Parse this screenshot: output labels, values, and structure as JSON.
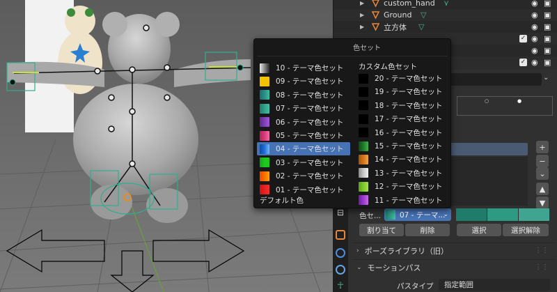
{
  "outliner": {
    "items": [
      {
        "name": "custom_hand",
        "icon": "armature-icon"
      },
      {
        "name": "Ground",
        "icon": "mesh-object-icon"
      },
      {
        "name": "立方体",
        "icon": "mesh-object-icon"
      }
    ]
  },
  "popup": {
    "title": "色セット",
    "custom_header": "カスタム色セット",
    "default_label": "デフォルト色",
    "left": [
      {
        "label": "10 - テーマ色セット",
        "colors": [
          "#e8e8e8",
          "#8a8a8a",
          "#2a2a2a"
        ]
      },
      {
        "label": "09 - テーマ色セット",
        "colors": [
          "#f5c400",
          "#f5c400",
          "#f5c400"
        ]
      },
      {
        "label": "08 - テーマ色セット",
        "colors": [
          "#1a6e73",
          "#2f8d86",
          "#3cbfa1"
        ]
      },
      {
        "label": "07 - テーマ色セット",
        "colors": [
          "#1f7c6a",
          "#32a18a",
          "#3fc0a4"
        ]
      },
      {
        "label": "06 - テーマ色セット",
        "colors": [
          "#5e2a8c",
          "#7e3fb5",
          "#a35ad9"
        ]
      },
      {
        "label": "05 - テーマ色セット",
        "colors": [
          "#b5265c",
          "#d63a7b",
          "#f26fa2"
        ]
      },
      {
        "label": "04 - テーマ色セット",
        "colors": [
          "#0b4aa8",
          "#1f6fd6",
          "#7bb8ff"
        ]
      },
      {
        "label": "03 - テーマ色セット",
        "colors": [
          "#15a31a",
          "#1ec91f",
          "#1ec91f"
        ]
      },
      {
        "label": "02 - テーマ色セット",
        "colors": [
          "#e84b00",
          "#ff6f00",
          "#ffa600"
        ]
      },
      {
        "label": "01 - テーマ色セット",
        "colors": [
          "#d01414",
          "#e62020",
          "#f23030"
        ]
      }
    ],
    "right": [
      {
        "label": "20 - テーマ色セット",
        "colors": [
          "#000000",
          "#000000",
          "#000000"
        ]
      },
      {
        "label": "19 - テーマ色セット",
        "colors": [
          "#000000",
          "#000000",
          "#000000"
        ]
      },
      {
        "label": "18 - テーマ色セット",
        "colors": [
          "#000000",
          "#000000",
          "#000000"
        ]
      },
      {
        "label": "17 - テーマ色セット",
        "colors": [
          "#000000",
          "#000000",
          "#000000"
        ]
      },
      {
        "label": "16 - テーマ色セット",
        "colors": [
          "#000000",
          "#000000",
          "#000000"
        ]
      },
      {
        "label": "15 - テーマ色セット",
        "colors": [
          "#0e4a16",
          "#1e7a2a",
          "#3fb04a"
        ]
      },
      {
        "label": "14 - テーマ色セット",
        "colors": [
          "#a3520f",
          "#d4741c",
          "#f0a44a"
        ]
      },
      {
        "label": "13 - テーマ色セット",
        "colors": [
          "#8a8a8a",
          "#c8c8c8",
          "#f0f0f0"
        ]
      },
      {
        "label": "12 - テーマ色セット",
        "colors": [
          "#5aa01a",
          "#7ecb2a",
          "#a8e04a"
        ]
      },
      {
        "label": "11 - テーマ色セット",
        "colors": [
          "#6a1fa0",
          "#9b39cc",
          "#c56ae6"
        ]
      }
    ],
    "selected_index": 6
  },
  "bone_group": {
    "color_label": "色セ...",
    "color_value": "07 - テーマ...",
    "assign_label": "割り当て",
    "remove_label": "削除",
    "select_label": "選択",
    "deselect_label": "選択解除"
  },
  "panels": {
    "pose_library": "ポーズライブラリ（旧）",
    "motion_paths": "モーションパス",
    "path_type_label": "パスタイプ",
    "path_type_value": "指定範囲"
  }
}
